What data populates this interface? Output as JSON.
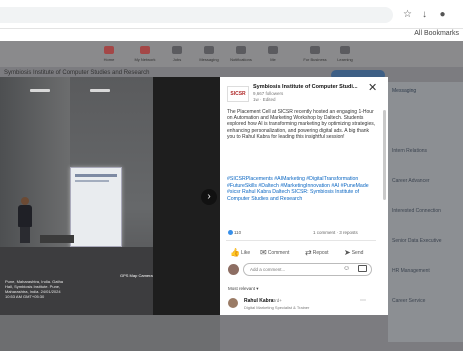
{
  "browser": {
    "bookmarks_label": "All Bookmarks",
    "icons": [
      "reading-mode-icon",
      "download-icon",
      "profile-icon"
    ]
  },
  "page": {
    "left_caption": "Symbiosis Institute of Computer Studies and Research",
    "nav_labels": [
      "Home",
      "My Network",
      "Jobs",
      "Messaging",
      "Notifications",
      "Me",
      "For Business",
      "Learning"
    ],
    "right_items": [
      "Messaging",
      "Intern Relations",
      "Career Advancer",
      "Interested Connection",
      "Senior Data Executive",
      "HR Management",
      "Career Service"
    ]
  },
  "photo": {
    "caption": "Pune, Maharashtra, India. Gatha Hall, Symbiosis Institute. Pune, Maharashtra, India. 24/01/2024 10:53 AM GMT+05:30",
    "badge": "GPS Map Camera"
  },
  "post": {
    "org_logo": "SICSR",
    "org_name": "Symbiosis Institute of Computer Studi...",
    "org_followers": "9,667 followers",
    "org_time": "1w · Edited",
    "body": "The Placement Cell at SICSR recently hosted an engaging 1-Hour on Automation and Marketing Workshop by Daltech. Students explored how AI is transforming marketing by optimizing strategies, enhancing personalization, and powering digital ads. A big thank you to Rahul Kabra for leading this insightful session!",
    "hashtags": "#SICSRPlacements #AIMarketing #DigitalTransformation #FutureSkills #Daltech #MarketingInnovation #AI #PuneMade #sicsr Rahul Kabra Daltech SICSR: Symbiosis Institute of Computer Studies and Research",
    "reactions": "110",
    "comments": "1 comment · 3 reposts",
    "actions": [
      "Like",
      "Comment",
      "Repost",
      "Send"
    ],
    "comment_placeholder": "Add a comment...",
    "sort_label": "Most relevant",
    "commenter_name": "Rahul Kabra",
    "commenter_degree": "· 3rd+",
    "commenter_headline": "Digital Marketing Specialist & Trainer"
  },
  "colors": {
    "link": "#0a66c2",
    "overlay": "#7c7c80"
  }
}
